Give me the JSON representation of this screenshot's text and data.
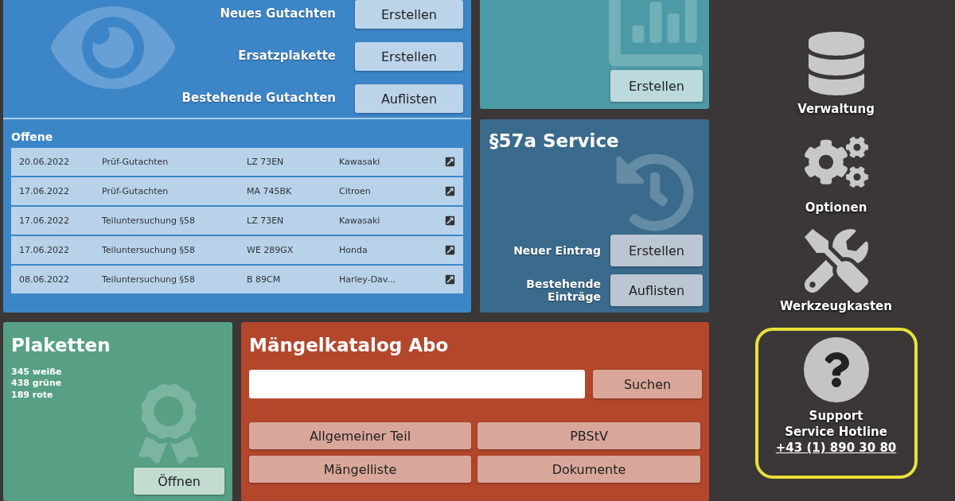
{
  "gutachten": {
    "actions": [
      {
        "label": "Neues Gutachten",
        "button": "Erstellen"
      },
      {
        "label": "Ersatzplakette",
        "button": "Erstellen"
      },
      {
        "label": "Bestehende Gutachten",
        "button": "Auflisten"
      }
    ],
    "open_title": "Offene",
    "rows": [
      {
        "date": "20.06.2022",
        "type": "Prüf-Gutachten",
        "plate": "LZ 73EN",
        "make": "Kawasaki"
      },
      {
        "date": "17.06.2022",
        "type": "Prüf-Gutachten",
        "plate": "MA 745BK",
        "make": "Citroen"
      },
      {
        "date": "17.06.2022",
        "type": "Teiluntersuchung §58",
        "plate": "LZ 73EN",
        "make": "Kawasaki"
      },
      {
        "date": "17.06.2022",
        "type": "Teiluntersuchung §58",
        "plate": "WE 289GX",
        "make": "Honda"
      },
      {
        "date": "08.06.2022",
        "type": "Teiluntersuchung §58",
        "plate": "B 89CM",
        "make": "Harley-Dav..."
      }
    ]
  },
  "statistik": {
    "button": "Erstellen"
  },
  "service": {
    "title": "§57a Service",
    "actions": [
      {
        "label": "Neuer Eintrag",
        "button": "Erstellen"
      },
      {
        "label": "Bestehende Einträge",
        "button": "Auflisten"
      }
    ]
  },
  "plaketten": {
    "title": "Plaketten",
    "counts": [
      "345 weiße",
      "438 grüne",
      "189 rote"
    ],
    "button": "Öffnen"
  },
  "maengelkatalog": {
    "title": "Mängelkatalog Abo",
    "search_button": "Suchen",
    "buttons": [
      "Allgemeiner Teil",
      "PBStV",
      "Mängelliste",
      "Dokumente"
    ]
  },
  "sidebar": {
    "items": [
      {
        "kind": "database",
        "label": "Verwaltung"
      },
      {
        "kind": "gears",
        "label": "Optionen"
      },
      {
        "kind": "tools",
        "label": "Werkzeugkasten"
      }
    ],
    "support": {
      "title": "Support",
      "subtitle": "Service Hotline",
      "phone": "+43 (1) 890 30 80",
      "highlighted": true
    }
  }
}
